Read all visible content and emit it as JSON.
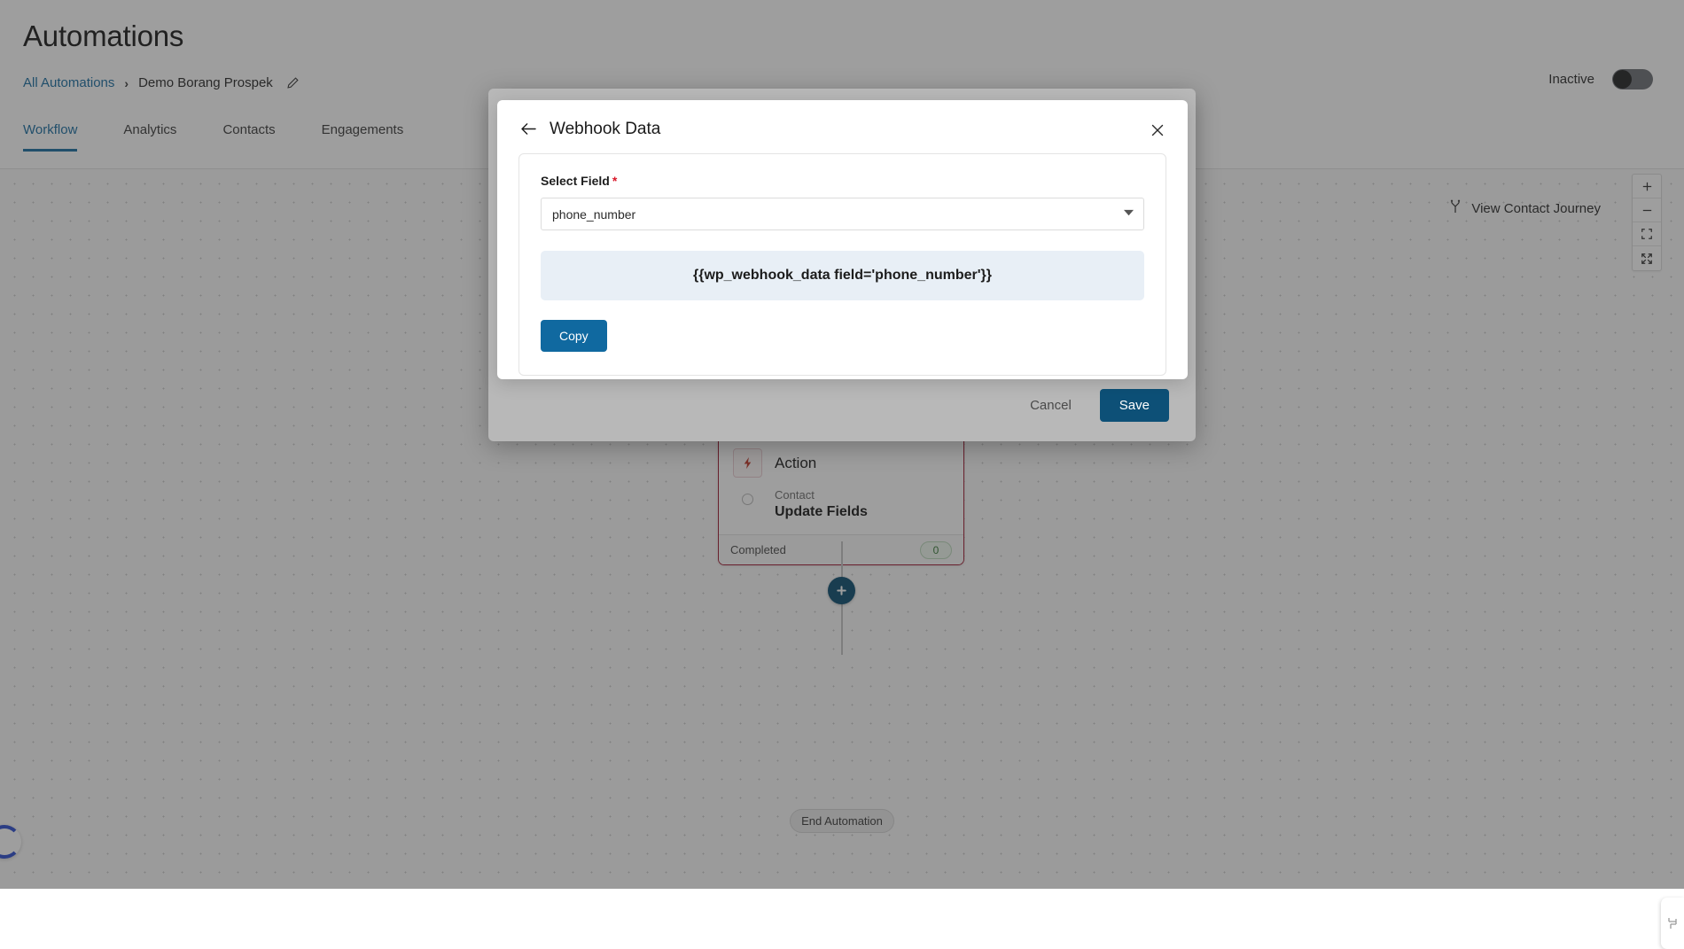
{
  "header": {
    "title": "Automations",
    "breadcrumb": {
      "root": "All Automations",
      "separator": "›",
      "current": "Demo Borang Prospek",
      "edit_icon": "pencil-icon"
    },
    "status": {
      "label": "Inactive",
      "toggle_state": "off"
    },
    "tabs": [
      {
        "label": "Workflow",
        "active": true
      },
      {
        "label": "Analytics",
        "active": false
      },
      {
        "label": "Contacts",
        "active": false
      },
      {
        "label": "Engagements",
        "active": false
      }
    ]
  },
  "canvas": {
    "journey_button": "View Contact Journey",
    "journey_icon": "branch-icon",
    "zoom_controls": [
      {
        "name": "zoom-in-button",
        "icon": "plus-icon",
        "glyph": "＋"
      },
      {
        "name": "zoom-out-button",
        "icon": "minus-icon",
        "glyph": "−"
      },
      {
        "name": "fit-view-button",
        "icon": "fit-frame-icon",
        "glyph": "⛶"
      },
      {
        "name": "fullscreen-button",
        "icon": "expand-arrows-icon",
        "glyph": "⤡"
      }
    ],
    "node": {
      "badge_icon": "lightning-icon",
      "title": "Action",
      "subtitle": "Contact",
      "name": "Update Fields",
      "status": "Completed",
      "count": "0"
    },
    "add_step_icon": "plus-circle-icon",
    "end_node": "End Automation",
    "loading_icon": "spinner-icon",
    "edge_handle_icon": "workflow-panel-icon"
  },
  "outer_dialog": {
    "cancel_label": "Cancel",
    "save_label": "Save"
  },
  "dialog": {
    "back_icon": "arrow-left-icon",
    "title": "Webhook Data",
    "close_icon": "close-icon",
    "field": {
      "label": "Select Field",
      "required_marker": "*",
      "selected_value": "phone_number",
      "caret_icon": "chevron-down-icon"
    },
    "token": "{{wp_webhook_data field='phone_number'}}",
    "copy_label": "Copy"
  },
  "colors": {
    "accent": "#1d6fa3",
    "primary_button": "#0d5077",
    "copy_button": "#1069a0",
    "node_border": "#9e1b32",
    "token_bg": "#e8eff6",
    "required": "#d9182a"
  }
}
